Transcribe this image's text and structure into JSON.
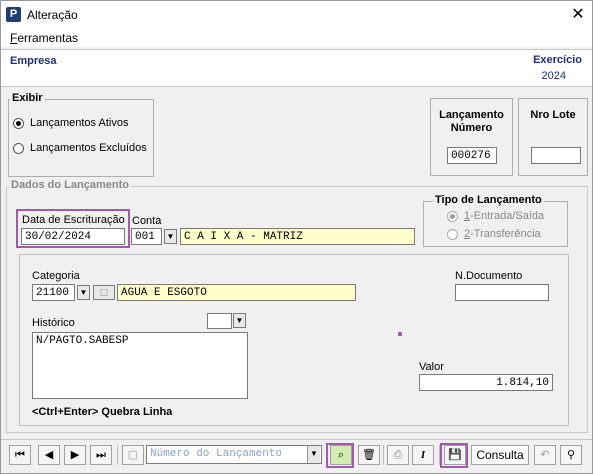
{
  "window": {
    "title": "Alteração",
    "app_icon_letter": "P"
  },
  "menu": {
    "items": [
      {
        "underline": "F",
        "rest": "erramentas"
      }
    ]
  },
  "header": {
    "empresa_label": "Empresa",
    "exercicio_label": "Exercício",
    "exercicio_value": "2024"
  },
  "exibir": {
    "label": "Exibir",
    "options": [
      {
        "label": "Lançamentos Ativos",
        "selected": true
      },
      {
        "label": "Lançamentos Excluídos",
        "selected": false
      }
    ]
  },
  "lancamento": {
    "label_line1": "Lançamento",
    "label_line2": "Número",
    "value": "000276"
  },
  "nro_lote": {
    "label": "Nro Lote",
    "value": ""
  },
  "dados": {
    "label": "Dados do Lançamento",
    "data_label": "Data de Escrituração",
    "data_value": "30/02/2024",
    "conta_label": "Conta",
    "conta_code": "001",
    "conta_desc": "C A I X A - MATRIZ",
    "tipo_label": "Tipo de Lançamento",
    "tipo_options": [
      {
        "num": "1",
        "rest": "-Entrada/Saída",
        "selected": true
      },
      {
        "num": "2",
        "rest": "-Transferência",
        "selected": false
      }
    ],
    "categoria_label": "Categoria",
    "categoria_code": "21100",
    "categoria_desc": "AGUA E ESGOTO",
    "ndocumento_label": "N.Documento",
    "ndocumento_value": "",
    "historico_label": "Histórico",
    "historico_value": "N/PAGTO.SABESP",
    "valor_label": "Valor",
    "valor_value": "1.814,10",
    "hint": "<Ctrl+Enter> Quebra Linha"
  },
  "toolbar": {
    "search_placeholder": "Número do Lançamento",
    "consulta_label": "Consulta"
  },
  "colors": {
    "highlight": "#a15ba8",
    "header_text": "#1c2f7a",
    "yellow_field": "#ffffcc"
  }
}
